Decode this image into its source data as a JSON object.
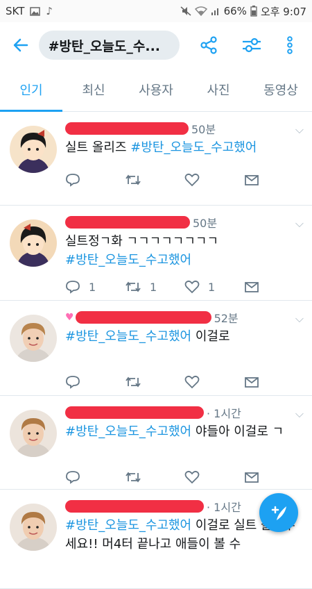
{
  "status": {
    "carrier": "SKT",
    "battery": "66%",
    "time": "오후 9:07"
  },
  "header": {
    "search_query": "#방탄_오늘도_수..."
  },
  "tabs": [
    "인기",
    "최신",
    "사용자",
    "사진",
    "동영상"
  ],
  "tweets": [
    {
      "time": "50분",
      "text_plain": "실트 올리즈 ",
      "hashtag": "#방탄_오늘도_수고했어",
      "text_after": "",
      "reply": "",
      "retweet": "",
      "like": ""
    },
    {
      "time": "50분",
      "text_plain": "실트정ㄱ화 ㄱㄱㄱㄱㄱㄱㄱㄱ",
      "hashtag": "#방탄_오늘도_수고했어",
      "text_after": "",
      "reply": "1",
      "retweet": "1",
      "like": "1"
    },
    {
      "time": "52분",
      "text_plain": "",
      "hashtag": "#방탄_오늘도_수고했어",
      "text_after": " 이걸로",
      "reply": "",
      "retweet": "",
      "like": ""
    },
    {
      "time": "· 1시간",
      "text_plain": "",
      "hashtag": "#방탄_오늘도_수고했어",
      "text_after": " 야들아 이걸로 ㄱ",
      "reply": "",
      "retweet": "",
      "like": ""
    },
    {
      "time": "· 1시간",
      "text_plain": "",
      "hashtag": "#방탄_오늘도_수고했어",
      "text_after": " 이걸로 실트 올려주세요!! 머4터 끝나고 애들이 볼 수",
      "reply": "",
      "retweet": "",
      "like": ""
    }
  ],
  "colors": {
    "accent": "#1da1f2",
    "redaction": "#f0243a"
  },
  "icons": [
    "back-arrow-icon",
    "share-icon",
    "filter-icon",
    "more-vertical-icon",
    "reply-icon",
    "retweet-icon",
    "like-icon",
    "dm-icon",
    "compose-icon"
  ]
}
